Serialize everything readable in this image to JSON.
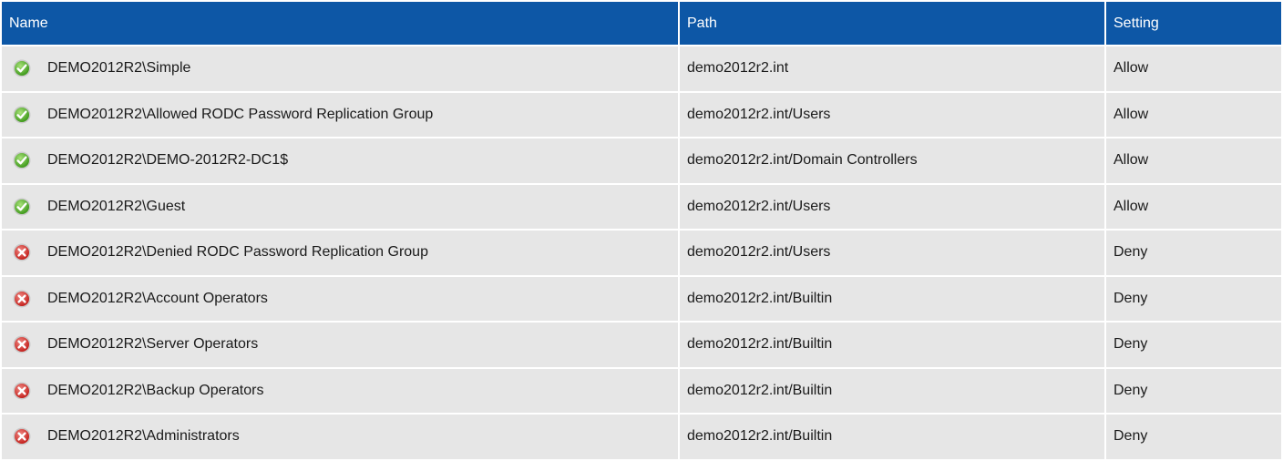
{
  "table": {
    "headers": {
      "name": "Name",
      "path": "Path",
      "setting": "Setting"
    },
    "rows": [
      {
        "status_icon": "allow-check-icon",
        "name": "DEMO2012R2\\Simple",
        "path": "demo2012r2.int",
        "setting": "Allow"
      },
      {
        "status_icon": "allow-check-icon",
        "name": "DEMO2012R2\\Allowed RODC Password Replication Group",
        "path": "demo2012r2.int/Users",
        "setting": "Allow"
      },
      {
        "status_icon": "allow-check-icon",
        "name": "DEMO2012R2\\DEMO-2012R2-DC1$",
        "path": "demo2012r2.int/Domain Controllers",
        "setting": "Allow"
      },
      {
        "status_icon": "allow-check-icon",
        "name": "DEMO2012R2\\Guest",
        "path": "demo2012r2.int/Users",
        "setting": "Allow"
      },
      {
        "status_icon": "deny-x-icon",
        "name": "DEMO2012R2\\Denied RODC Password Replication Group",
        "path": "demo2012r2.int/Users",
        "setting": "Deny"
      },
      {
        "status_icon": "deny-x-icon",
        "name": "DEMO2012R2\\Account Operators",
        "path": "demo2012r2.int/Builtin",
        "setting": "Deny"
      },
      {
        "status_icon": "deny-x-icon",
        "name": "DEMO2012R2\\Server Operators",
        "path": "demo2012r2.int/Builtin",
        "setting": "Deny"
      },
      {
        "status_icon": "deny-x-icon",
        "name": "DEMO2012R2\\Backup Operators",
        "path": "demo2012r2.int/Builtin",
        "setting": "Deny"
      },
      {
        "status_icon": "deny-x-icon",
        "name": "DEMO2012R2\\Administrators",
        "path": "demo2012r2.int/Builtin",
        "setting": "Deny"
      }
    ]
  },
  "colors": {
    "header_bg": "#0d57a6",
    "row_bg": "#e6e6e6",
    "allow_icon": "#5cb82e",
    "deny_icon": "#d9322e"
  }
}
